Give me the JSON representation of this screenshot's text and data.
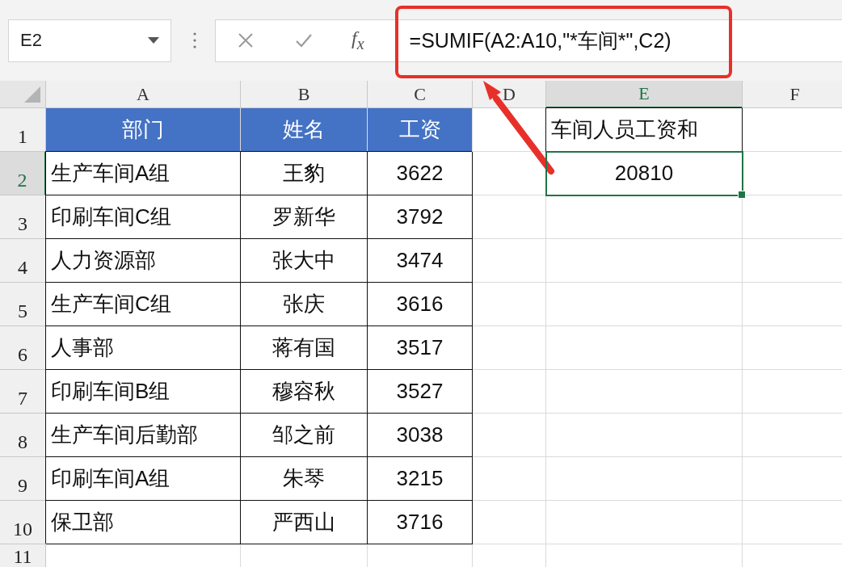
{
  "name_box": "E2",
  "formula_bar": {
    "fx": "f$_{x}$",
    "formula": "=SUMIF(A2:A10,\"*车间*\",C2)"
  },
  "columns": [
    {
      "label": "A",
      "selected": false
    },
    {
      "label": "B",
      "selected": false
    },
    {
      "label": "C",
      "selected": false
    },
    {
      "label": "D",
      "selected": false
    },
    {
      "label": "E",
      "selected": true
    },
    {
      "label": "F",
      "selected": false
    }
  ],
  "rows": [
    {
      "number": "1",
      "selected": false,
      "cells": [
        {
          "kind": "header",
          "text": "部门"
        },
        {
          "kind": "header",
          "text": "姓名"
        },
        {
          "kind": "header",
          "text": "工资"
        },
        {
          "kind": "empty"
        },
        {
          "kind": "label",
          "text": "车间人员工资和"
        },
        {
          "kind": "empty"
        }
      ]
    },
    {
      "number": "2",
      "selected": true,
      "cells": [
        {
          "kind": "data",
          "text": "生产车间A组"
        },
        {
          "kind": "data",
          "text": "王豹"
        },
        {
          "kind": "data",
          "text": "3622"
        },
        {
          "kind": "empty"
        },
        {
          "kind": "result",
          "text": "20810"
        },
        {
          "kind": "empty"
        }
      ]
    },
    {
      "number": "3",
      "selected": false,
      "cells": [
        {
          "kind": "data",
          "text": "印刷车间C组"
        },
        {
          "kind": "data",
          "text": "罗新华"
        },
        {
          "kind": "data",
          "text": "3792"
        },
        {
          "kind": "empty"
        },
        {
          "kind": "empty"
        },
        {
          "kind": "empty"
        }
      ]
    },
    {
      "number": "4",
      "selected": false,
      "cells": [
        {
          "kind": "data",
          "text": "人力资源部"
        },
        {
          "kind": "data",
          "text": "张大中"
        },
        {
          "kind": "data",
          "text": "3474"
        },
        {
          "kind": "empty"
        },
        {
          "kind": "empty"
        },
        {
          "kind": "empty"
        }
      ]
    },
    {
      "number": "5",
      "selected": false,
      "cells": [
        {
          "kind": "data",
          "text": "生产车间C组"
        },
        {
          "kind": "data",
          "text": "张庆"
        },
        {
          "kind": "data",
          "text": "3616"
        },
        {
          "kind": "empty"
        },
        {
          "kind": "empty"
        },
        {
          "kind": "empty"
        }
      ]
    },
    {
      "number": "6",
      "selected": false,
      "cells": [
        {
          "kind": "data",
          "text": "人事部"
        },
        {
          "kind": "data",
          "text": "蒋有国"
        },
        {
          "kind": "data",
          "text": "3517"
        },
        {
          "kind": "empty"
        },
        {
          "kind": "empty"
        },
        {
          "kind": "empty"
        }
      ]
    },
    {
      "number": "7",
      "selected": false,
      "cells": [
        {
          "kind": "data",
          "text": "印刷车间B组"
        },
        {
          "kind": "data",
          "text": "穆容秋"
        },
        {
          "kind": "data",
          "text": "3527"
        },
        {
          "kind": "empty"
        },
        {
          "kind": "empty"
        },
        {
          "kind": "empty"
        }
      ]
    },
    {
      "number": "8",
      "selected": false,
      "cells": [
        {
          "kind": "data",
          "text": "生产车间后勤部"
        },
        {
          "kind": "data",
          "text": "邹之前"
        },
        {
          "kind": "data",
          "text": "3038"
        },
        {
          "kind": "empty"
        },
        {
          "kind": "empty"
        },
        {
          "kind": "empty"
        }
      ]
    },
    {
      "number": "9",
      "selected": false,
      "cells": [
        {
          "kind": "data",
          "text": "印刷车间A组"
        },
        {
          "kind": "data",
          "text": "朱琴"
        },
        {
          "kind": "data",
          "text": "3215"
        },
        {
          "kind": "empty"
        },
        {
          "kind": "empty"
        },
        {
          "kind": "empty"
        }
      ]
    },
    {
      "number": "10",
      "selected": false,
      "cells": [
        {
          "kind": "data",
          "text": "保卫部"
        },
        {
          "kind": "data",
          "text": "严西山"
        },
        {
          "kind": "data",
          "text": "3716"
        },
        {
          "kind": "empty"
        },
        {
          "kind": "empty"
        },
        {
          "kind": "empty"
        }
      ]
    },
    {
      "number": "11",
      "selected": false,
      "cells": [
        {
          "kind": "empty"
        },
        {
          "kind": "empty"
        },
        {
          "kind": "empty"
        },
        {
          "kind": "empty"
        },
        {
          "kind": "empty"
        },
        {
          "kind": "empty"
        }
      ]
    }
  ]
}
